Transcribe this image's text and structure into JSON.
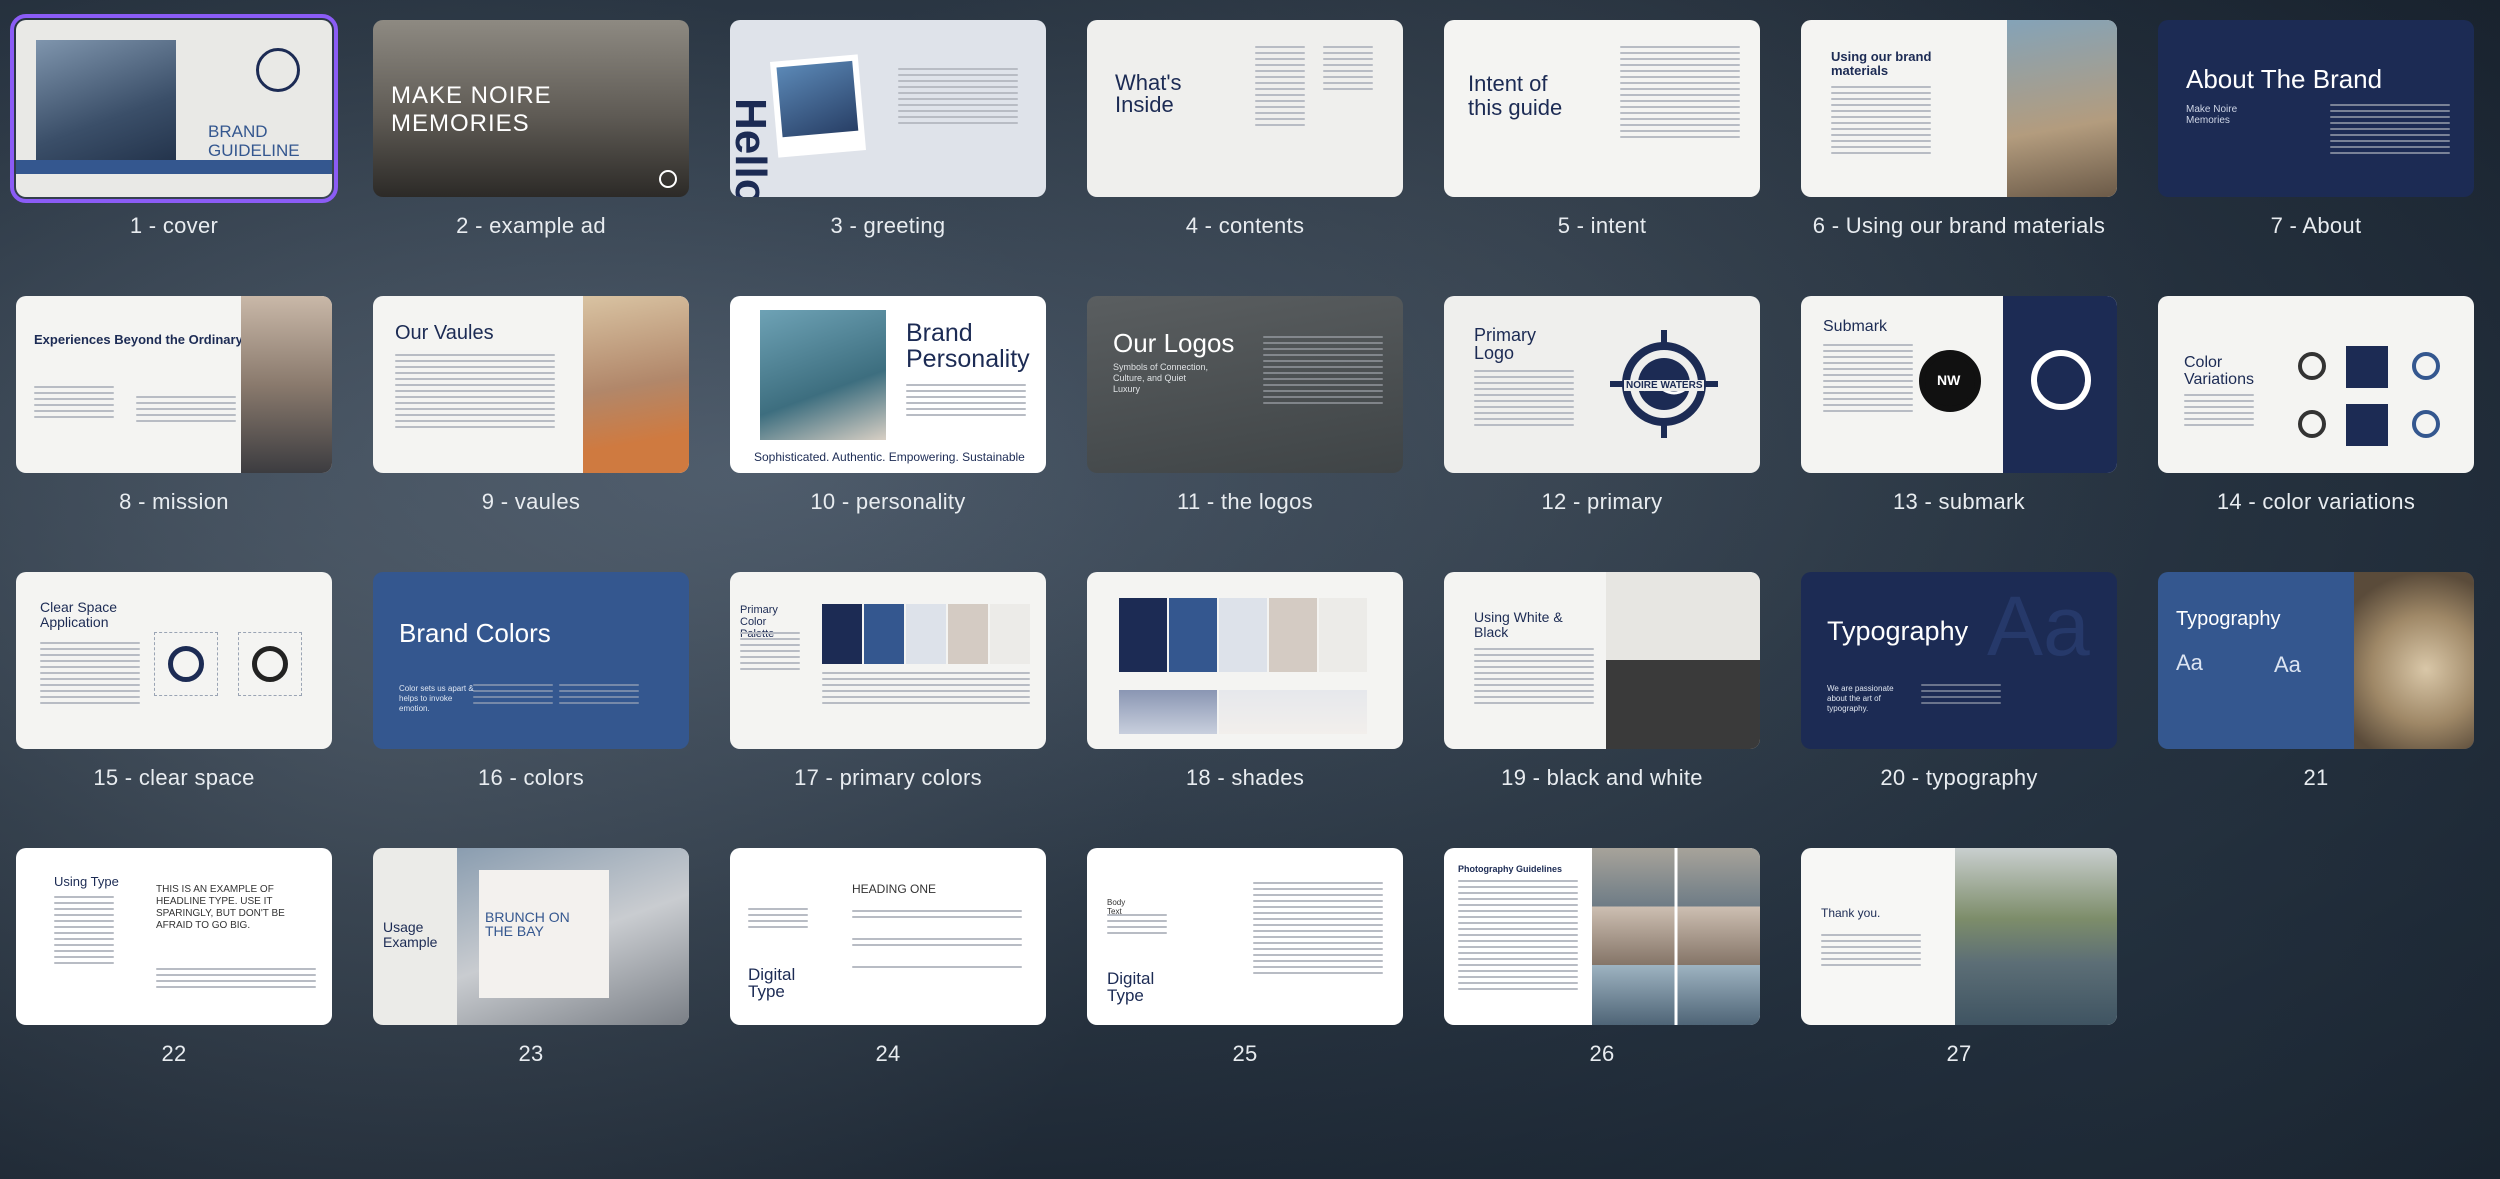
{
  "pages": [
    {
      "caption": "1 - cover",
      "title": "BRAND\nGUIDELINE",
      "selected": true
    },
    {
      "caption": "2 - example ad",
      "title": "MAKE NOIRE MEMORIES"
    },
    {
      "caption": "3 - greeting",
      "title": "Hello"
    },
    {
      "caption": "4 - contents",
      "title": "What's Inside"
    },
    {
      "caption": "5 - intent",
      "title": "Intent of this guide"
    },
    {
      "caption": "6 - Using our brand materials",
      "title": "Using our brand materials"
    },
    {
      "caption": "7 - About",
      "title": "About The Brand",
      "subtitle": "Make Noire Memories"
    },
    {
      "caption": "8 - mission",
      "title": "Experiences Beyond the Ordinary"
    },
    {
      "caption": "9 - vaules",
      "title": "Our Vaules"
    },
    {
      "caption": "10 - personality",
      "title": "Brand Personality",
      "footer": "Sophisticated. Authentic. Empowering. Sustainable"
    },
    {
      "caption": "11 - the logos",
      "title": "Our Logos",
      "subtitle": "Symbols of Connection, Culture, and Quiet Luxury"
    },
    {
      "caption": "12 - primary",
      "title": "Primary Logo",
      "logo_text": "NOIRE WATERS"
    },
    {
      "caption": "13 - submark",
      "title": "Submark",
      "logo_text": "NW"
    },
    {
      "caption": "14 - color variations",
      "title": "Color Variations"
    },
    {
      "caption": "15 - clear space",
      "title": "Clear Space Application"
    },
    {
      "caption": "16 - colors",
      "title": "Brand Colors",
      "subtitle": "Color sets us apart & helps to invoke emotion."
    },
    {
      "caption": "17 - primary colors",
      "title": "Primary Color Palette"
    },
    {
      "caption": "18 - shades",
      "title": ""
    },
    {
      "caption": "19 - black and white",
      "title": "Using White & Black"
    },
    {
      "caption": "20 - typography",
      "title": "Typography",
      "subtitle": "We are passionate about the art of typography.",
      "glyph": "Aa"
    },
    {
      "caption": "21",
      "title": "Typography",
      "glyph": "Aa"
    },
    {
      "caption": "22",
      "title": "Using Type",
      "subtitle": "THIS IS AN EXAMPLE OF HEADLINE TYPE. USE IT SPARINGLY, BUT DON'T BE AFRAID TO GO BIG."
    },
    {
      "caption": "23",
      "title": "Usage Example",
      "subtitle": "BRUNCH ON THE BAY"
    },
    {
      "caption": "24",
      "title": "Digital Type",
      "subtitle": "HEADING ONE"
    },
    {
      "caption": "25",
      "title": "Digital Type",
      "subtitle": "Body Text"
    },
    {
      "caption": "26",
      "title": "Photography Guidelines"
    },
    {
      "caption": "27",
      "title": "Thank you."
    }
  ],
  "colors": {
    "navy": "#1c2b54",
    "blue": "#34578f",
    "selection": "#8b5cf6",
    "light": "#f4f4f2"
  }
}
